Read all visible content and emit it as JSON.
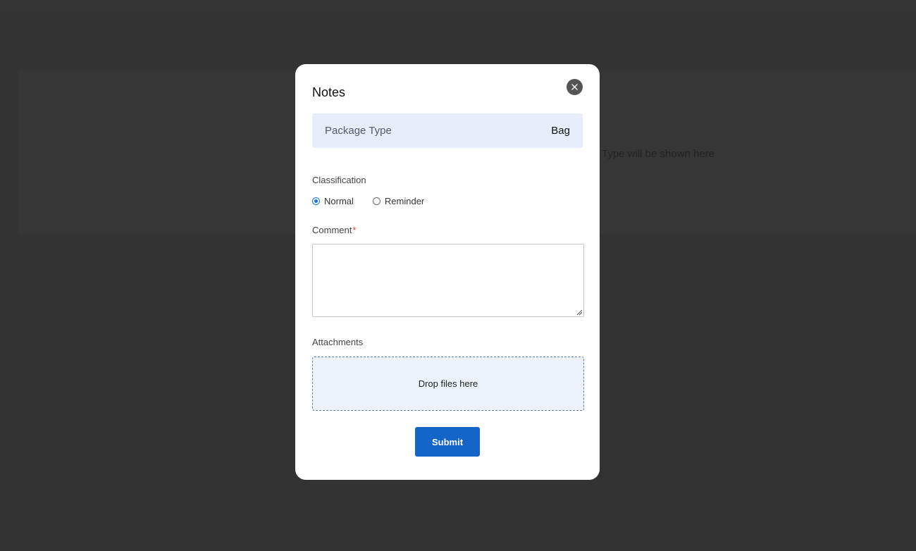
{
  "background": {
    "placeholder_text": "Type will be shown here"
  },
  "modal": {
    "title": "Notes",
    "close_icon": "close-icon",
    "package": {
      "label": "Package Type",
      "value": "Bag"
    },
    "classification": {
      "label": "Classification",
      "options": [
        "Normal",
        "Reminder"
      ],
      "selected": "Normal"
    },
    "comment": {
      "label": "Comment",
      "required_mark": "*",
      "value": "",
      "placeholder": ""
    },
    "attachments": {
      "label": "Attachments",
      "dropzone_text": "Drop files here"
    },
    "submit_label": "Submit"
  },
  "colors": {
    "overlay": "#333333",
    "accent": "#1565c8",
    "package_bg": "#e8edfb",
    "dropzone_bg": "#edf2fc",
    "required": "#e23b3b"
  }
}
